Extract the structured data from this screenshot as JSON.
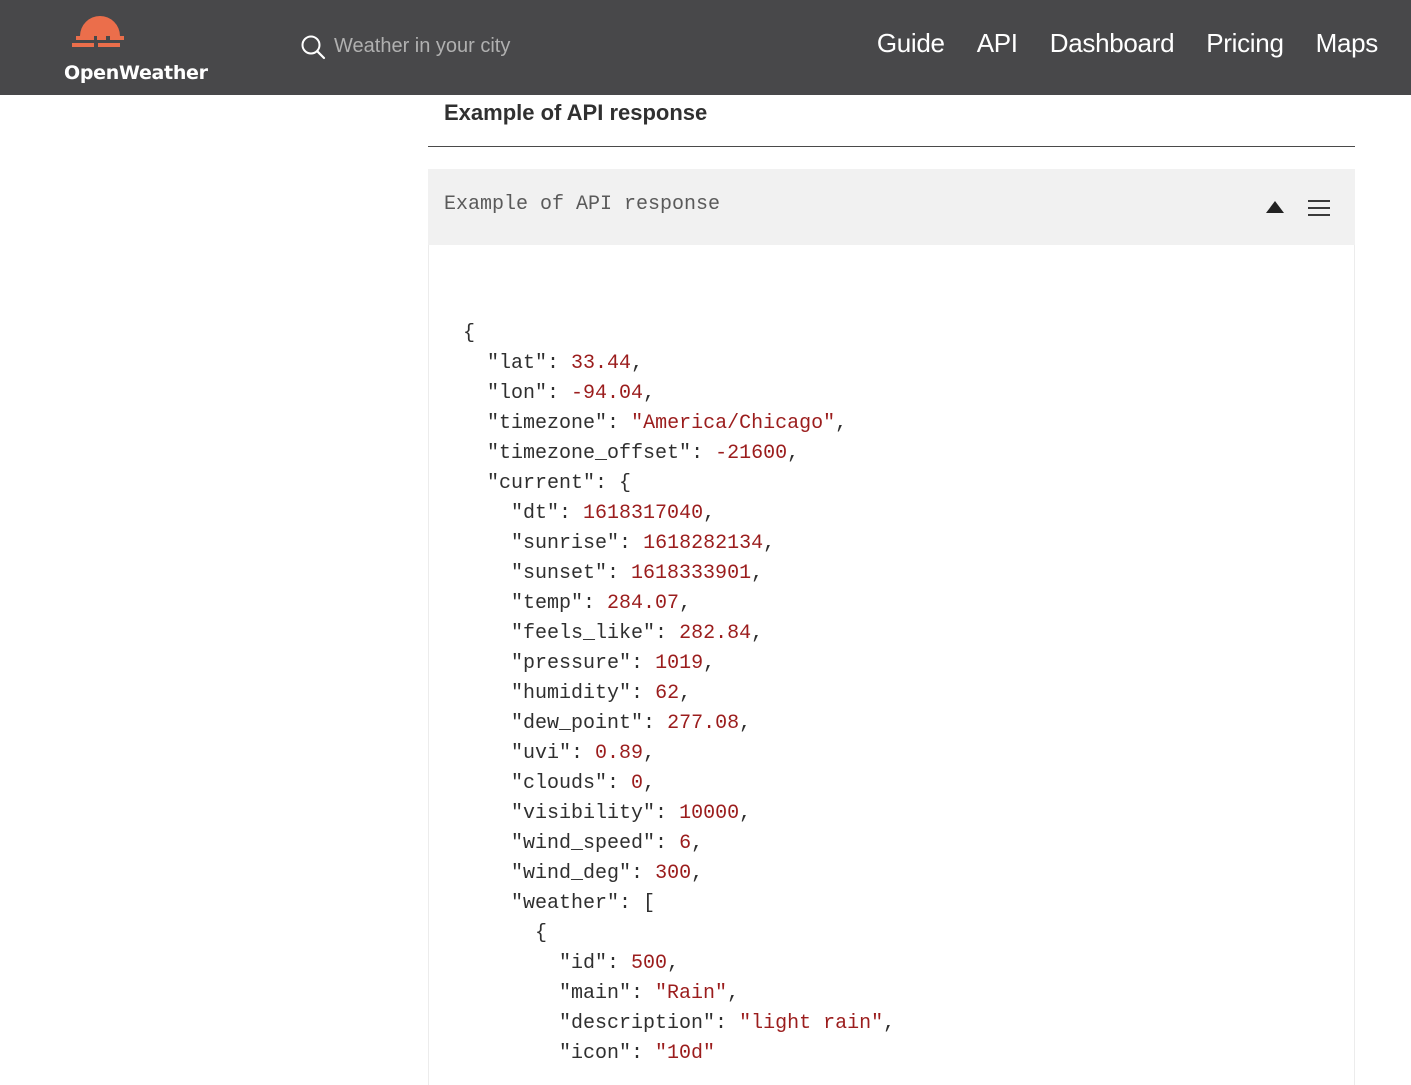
{
  "header": {
    "logo_text": "OpenWeather",
    "search_placeholder": "Weather in your city",
    "nav": [
      "Guide",
      "API",
      "Dashboard",
      "Pricing",
      "Maps"
    ]
  },
  "section": {
    "title": "Example of API response"
  },
  "code_block": {
    "title": "Example of API response",
    "lines": [
      [
        {
          "t": "p",
          "v": "{"
        }
      ],
      [
        {
          "t": "p",
          "v": "  "
        },
        {
          "t": "k",
          "v": "\"lat\""
        },
        {
          "t": "p",
          "v": ": "
        },
        {
          "t": "n",
          "v": "33.44"
        },
        {
          "t": "p",
          "v": ","
        }
      ],
      [
        {
          "t": "p",
          "v": "  "
        },
        {
          "t": "k",
          "v": "\"lon\""
        },
        {
          "t": "p",
          "v": ": "
        },
        {
          "t": "n",
          "v": "-94.04"
        },
        {
          "t": "p",
          "v": ","
        }
      ],
      [
        {
          "t": "p",
          "v": "  "
        },
        {
          "t": "k",
          "v": "\"timezone\""
        },
        {
          "t": "p",
          "v": ": "
        },
        {
          "t": "s",
          "v": "\"America/Chicago\""
        },
        {
          "t": "p",
          "v": ","
        }
      ],
      [
        {
          "t": "p",
          "v": "  "
        },
        {
          "t": "k",
          "v": "\"timezone_offset\""
        },
        {
          "t": "p",
          "v": ": "
        },
        {
          "t": "n",
          "v": "-21600"
        },
        {
          "t": "p",
          "v": ","
        }
      ],
      [
        {
          "t": "p",
          "v": "  "
        },
        {
          "t": "k",
          "v": "\"current\""
        },
        {
          "t": "p",
          "v": ": {"
        }
      ],
      [
        {
          "t": "p",
          "v": "    "
        },
        {
          "t": "k",
          "v": "\"dt\""
        },
        {
          "t": "p",
          "v": ": "
        },
        {
          "t": "n",
          "v": "1618317040"
        },
        {
          "t": "p",
          "v": ","
        }
      ],
      [
        {
          "t": "p",
          "v": "    "
        },
        {
          "t": "k",
          "v": "\"sunrise\""
        },
        {
          "t": "p",
          "v": ": "
        },
        {
          "t": "n",
          "v": "1618282134"
        },
        {
          "t": "p",
          "v": ","
        }
      ],
      [
        {
          "t": "p",
          "v": "    "
        },
        {
          "t": "k",
          "v": "\"sunset\""
        },
        {
          "t": "p",
          "v": ": "
        },
        {
          "t": "n",
          "v": "1618333901"
        },
        {
          "t": "p",
          "v": ","
        }
      ],
      [
        {
          "t": "p",
          "v": "    "
        },
        {
          "t": "k",
          "v": "\"temp\""
        },
        {
          "t": "p",
          "v": ": "
        },
        {
          "t": "n",
          "v": "284.07"
        },
        {
          "t": "p",
          "v": ","
        }
      ],
      [
        {
          "t": "p",
          "v": "    "
        },
        {
          "t": "k",
          "v": "\"feels_like\""
        },
        {
          "t": "p",
          "v": ": "
        },
        {
          "t": "n",
          "v": "282.84"
        },
        {
          "t": "p",
          "v": ","
        }
      ],
      [
        {
          "t": "p",
          "v": "    "
        },
        {
          "t": "k",
          "v": "\"pressure\""
        },
        {
          "t": "p",
          "v": ": "
        },
        {
          "t": "n",
          "v": "1019"
        },
        {
          "t": "p",
          "v": ","
        }
      ],
      [
        {
          "t": "p",
          "v": "    "
        },
        {
          "t": "k",
          "v": "\"humidity\""
        },
        {
          "t": "p",
          "v": ": "
        },
        {
          "t": "n",
          "v": "62"
        },
        {
          "t": "p",
          "v": ","
        }
      ],
      [
        {
          "t": "p",
          "v": "    "
        },
        {
          "t": "k",
          "v": "\"dew_point\""
        },
        {
          "t": "p",
          "v": ": "
        },
        {
          "t": "n",
          "v": "277.08"
        },
        {
          "t": "p",
          "v": ","
        }
      ],
      [
        {
          "t": "p",
          "v": "    "
        },
        {
          "t": "k",
          "v": "\"uvi\""
        },
        {
          "t": "p",
          "v": ": "
        },
        {
          "t": "n",
          "v": "0.89"
        },
        {
          "t": "p",
          "v": ","
        }
      ],
      [
        {
          "t": "p",
          "v": "    "
        },
        {
          "t": "k",
          "v": "\"clouds\""
        },
        {
          "t": "p",
          "v": ": "
        },
        {
          "t": "n",
          "v": "0"
        },
        {
          "t": "p",
          "v": ","
        }
      ],
      [
        {
          "t": "p",
          "v": "    "
        },
        {
          "t": "k",
          "v": "\"visibility\""
        },
        {
          "t": "p",
          "v": ": "
        },
        {
          "t": "n",
          "v": "10000"
        },
        {
          "t": "p",
          "v": ","
        }
      ],
      [
        {
          "t": "p",
          "v": "    "
        },
        {
          "t": "k",
          "v": "\"wind_speed\""
        },
        {
          "t": "p",
          "v": ": "
        },
        {
          "t": "n",
          "v": "6"
        },
        {
          "t": "p",
          "v": ","
        }
      ],
      [
        {
          "t": "p",
          "v": "    "
        },
        {
          "t": "k",
          "v": "\"wind_deg\""
        },
        {
          "t": "p",
          "v": ": "
        },
        {
          "t": "n",
          "v": "300"
        },
        {
          "t": "p",
          "v": ","
        }
      ],
      [
        {
          "t": "p",
          "v": "    "
        },
        {
          "t": "k",
          "v": "\"weather\""
        },
        {
          "t": "p",
          "v": ": ["
        }
      ],
      [
        {
          "t": "p",
          "v": "      {"
        }
      ],
      [
        {
          "t": "p",
          "v": "        "
        },
        {
          "t": "k",
          "v": "\"id\""
        },
        {
          "t": "p",
          "v": ": "
        },
        {
          "t": "n",
          "v": "500"
        },
        {
          "t": "p",
          "v": ","
        }
      ],
      [
        {
          "t": "p",
          "v": "        "
        },
        {
          "t": "k",
          "v": "\"main\""
        },
        {
          "t": "p",
          "v": ": "
        },
        {
          "t": "s",
          "v": "\"Rain\""
        },
        {
          "t": "p",
          "v": ","
        }
      ],
      [
        {
          "t": "p",
          "v": "        "
        },
        {
          "t": "k",
          "v": "\"description\""
        },
        {
          "t": "p",
          "v": ": "
        },
        {
          "t": "s",
          "v": "\"light rain\""
        },
        {
          "t": "p",
          "v": ","
        }
      ],
      [
        {
          "t": "p",
          "v": "        "
        },
        {
          "t": "k",
          "v": "\"icon\""
        },
        {
          "t": "p",
          "v": ": "
        },
        {
          "t": "s",
          "v": "\"10d\""
        }
      ]
    ]
  },
  "icons": {
    "logo": "openweather-sun-logo",
    "search": "search-icon",
    "collapse": "triangle-up-icon",
    "menu": "hamburger-menu-icon"
  },
  "colors": {
    "header_bg": "#48484a",
    "brand_orange": "#eb6e4b",
    "code_value": "#9b1d1d",
    "code_header_bg": "#f1f1f1"
  }
}
